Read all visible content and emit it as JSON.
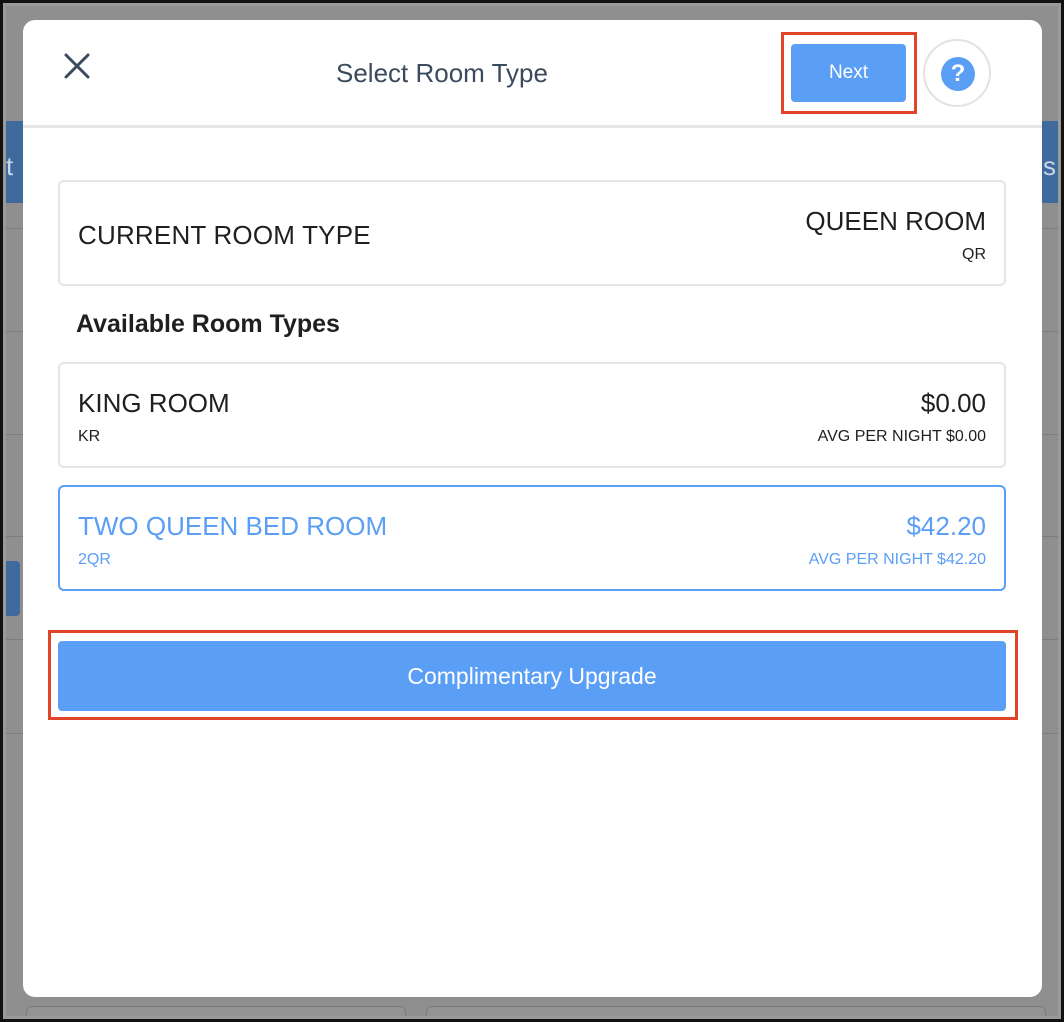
{
  "background": {
    "bar_text_left": "t",
    "bar_text_right": "s"
  },
  "modal": {
    "title": "Select Room Type",
    "close_icon": "close-icon",
    "next_label": "Next",
    "help_label": "?"
  },
  "current_room": {
    "label": "CURRENT ROOM TYPE",
    "name": "QUEEN ROOM",
    "code": "QR"
  },
  "available": {
    "heading": "Available Room Types",
    "rooms": [
      {
        "name": "KING ROOM",
        "code": "KR",
        "price": "$0.00",
        "avg": "AVG PER NIGHT $0.00",
        "selected": false
      },
      {
        "name": "TWO QUEEN BED ROOM",
        "code": "2QR",
        "price": "$42.20",
        "avg": "AVG PER NIGHT $42.20",
        "selected": true
      }
    ]
  },
  "actions": {
    "upgrade_label": "Complimentary Upgrade"
  },
  "colors": {
    "accent": "#5b9ef5",
    "highlight": "#e0452a",
    "text": "#1f1f1f"
  }
}
